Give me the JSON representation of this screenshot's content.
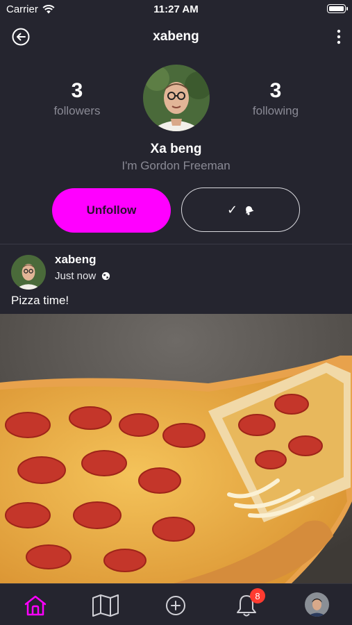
{
  "status_bar": {
    "carrier": "Carrier",
    "time": "11:27 AM"
  },
  "nav": {
    "title": "xabeng",
    "back_icon": "back-arrow-circle-icon",
    "more_icon": "vertical-dots-icon"
  },
  "profile": {
    "followers_count": "3",
    "followers_label": "followers",
    "following_count": "3",
    "following_label": "following",
    "name": "Xa beng",
    "bio": "I'm Gordon Freeman"
  },
  "actions": {
    "unfollow_label": "Unfollow",
    "notify_check": "✓",
    "notify_icon": "bell-icon"
  },
  "post": {
    "username": "xabeng",
    "time": "Just now",
    "visibility_icon": "globe-icon",
    "text": "Pizza time!",
    "image_icon": "pizza-photo"
  },
  "tab_bar": {
    "items": [
      {
        "name": "home",
        "icon": "home-icon",
        "active": true
      },
      {
        "name": "map",
        "icon": "map-icon"
      },
      {
        "name": "add",
        "icon": "plus-circle-icon"
      },
      {
        "name": "notifications",
        "icon": "bell-icon",
        "badge": "8"
      },
      {
        "name": "profile",
        "icon": "avatar"
      }
    ]
  },
  "colors": {
    "accent": "#ff00ff",
    "background": "#25252f",
    "muted": "#8a8a95",
    "badge": "#ff3b30"
  }
}
